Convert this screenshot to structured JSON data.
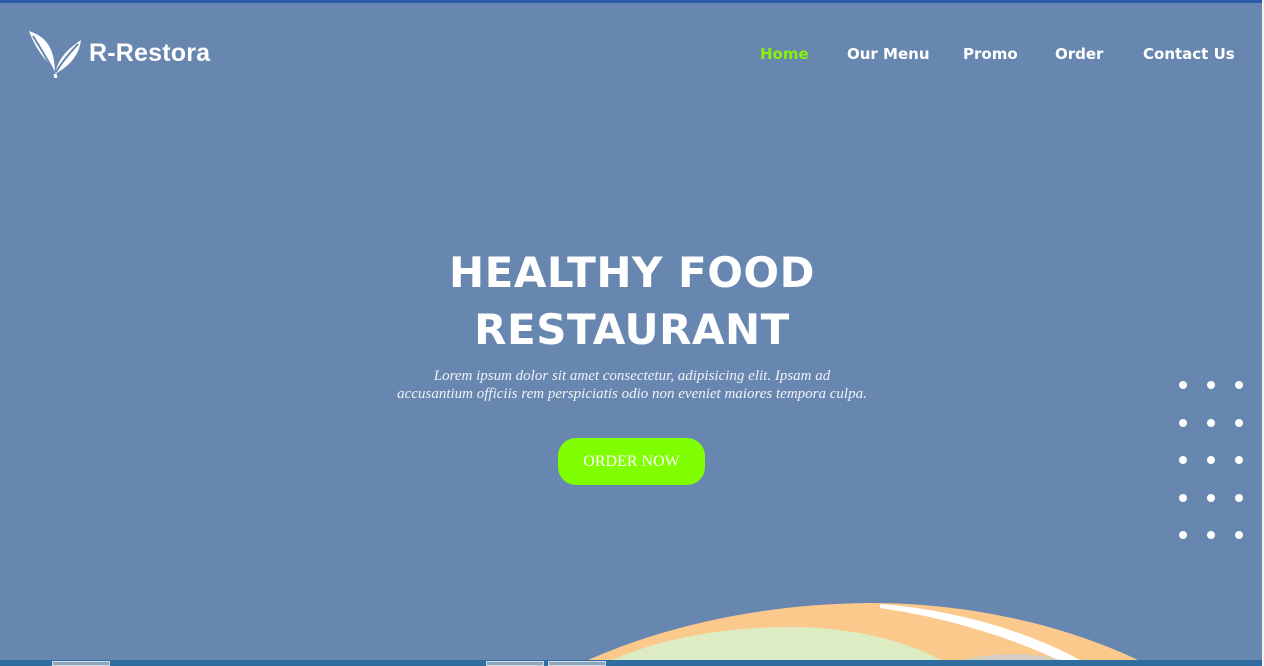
{
  "brand": {
    "name": "R-Restora",
    "icon": "leaf-logo-icon"
  },
  "nav": {
    "items": [
      {
        "label": "Home",
        "active": true
      },
      {
        "label": "Our Menu",
        "active": false
      },
      {
        "label": "Promo",
        "active": false
      },
      {
        "label": "Order",
        "active": false
      },
      {
        "label": "Contact Us",
        "active": false
      }
    ]
  },
  "hero": {
    "title_line1": "HEALTHY FOOD",
    "title_line2": "RESTAURANT",
    "description_line1": "Lorem ipsum dolor sit amet consectetur, adipisicing elit. Ipsam ad",
    "description_line2": "accusantium officiis rem perspiciatis odio non eveniet maiores tempora culpa.",
    "cta_label": "ORDER NOW"
  },
  "colors": {
    "background": "#6887b0",
    "accent": "#80ff00",
    "nav_active": "#86f20b",
    "text": "#ffffff",
    "plate_orange": "#fbc98c",
    "plate_green": "#deecc4"
  }
}
